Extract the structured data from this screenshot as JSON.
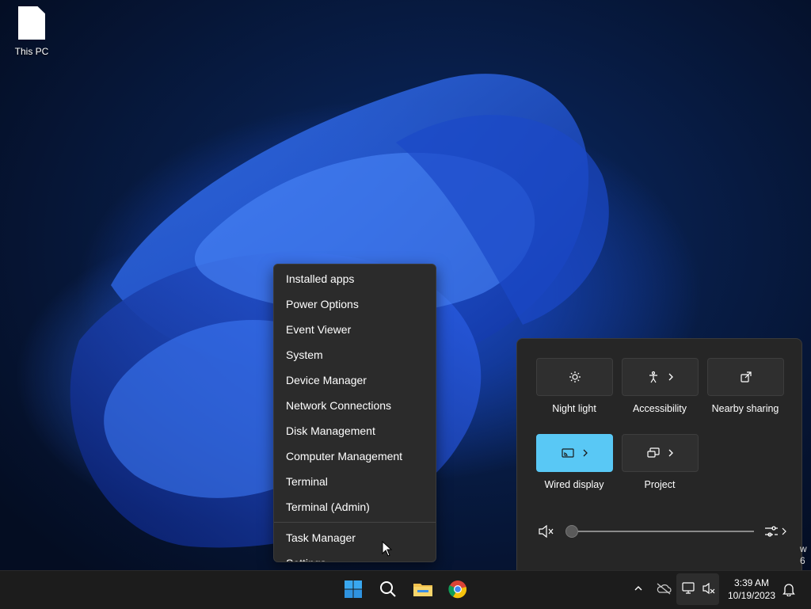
{
  "desktop": {
    "icons": [
      {
        "label": "This PC",
        "icon": "file-icon"
      }
    ]
  },
  "context_menu": {
    "items": [
      "Installed apps",
      "Power Options",
      "Event Viewer",
      "System",
      "Device Manager",
      "Network Connections",
      "Disk Management",
      "Computer Management",
      "Terminal",
      "Terminal (Admin)",
      "Task Manager",
      "Settings"
    ]
  },
  "quick_settings": {
    "tiles": [
      {
        "label": "Night light",
        "icon": "night-light-icon",
        "active": false,
        "has_chevron": false
      },
      {
        "label": "Accessibility",
        "icon": "accessibility-icon",
        "active": false,
        "has_chevron": true
      },
      {
        "label": "Nearby sharing",
        "icon": "share-icon",
        "active": false,
        "has_chevron": false
      },
      {
        "label": "Wired display",
        "icon": "cast-icon",
        "active": true,
        "has_chevron": true
      },
      {
        "label": "Project",
        "icon": "project-icon",
        "active": false,
        "has_chevron": true
      }
    ],
    "volume": {
      "muted": true,
      "level": 0
    }
  },
  "taskbar": {
    "pinned": [
      "start-icon",
      "search-icon",
      "file-explorer-icon",
      "chrome-icon"
    ],
    "clock": {
      "time": "3:39 AM",
      "date": "10/19/2023"
    }
  },
  "edge_text": {
    "line1": "w",
    "line2": "6"
  },
  "colors": {
    "accent": "#59c8f5",
    "menu_bg": "#2b2b2b",
    "taskbar_bg": "#1c1c1c"
  }
}
